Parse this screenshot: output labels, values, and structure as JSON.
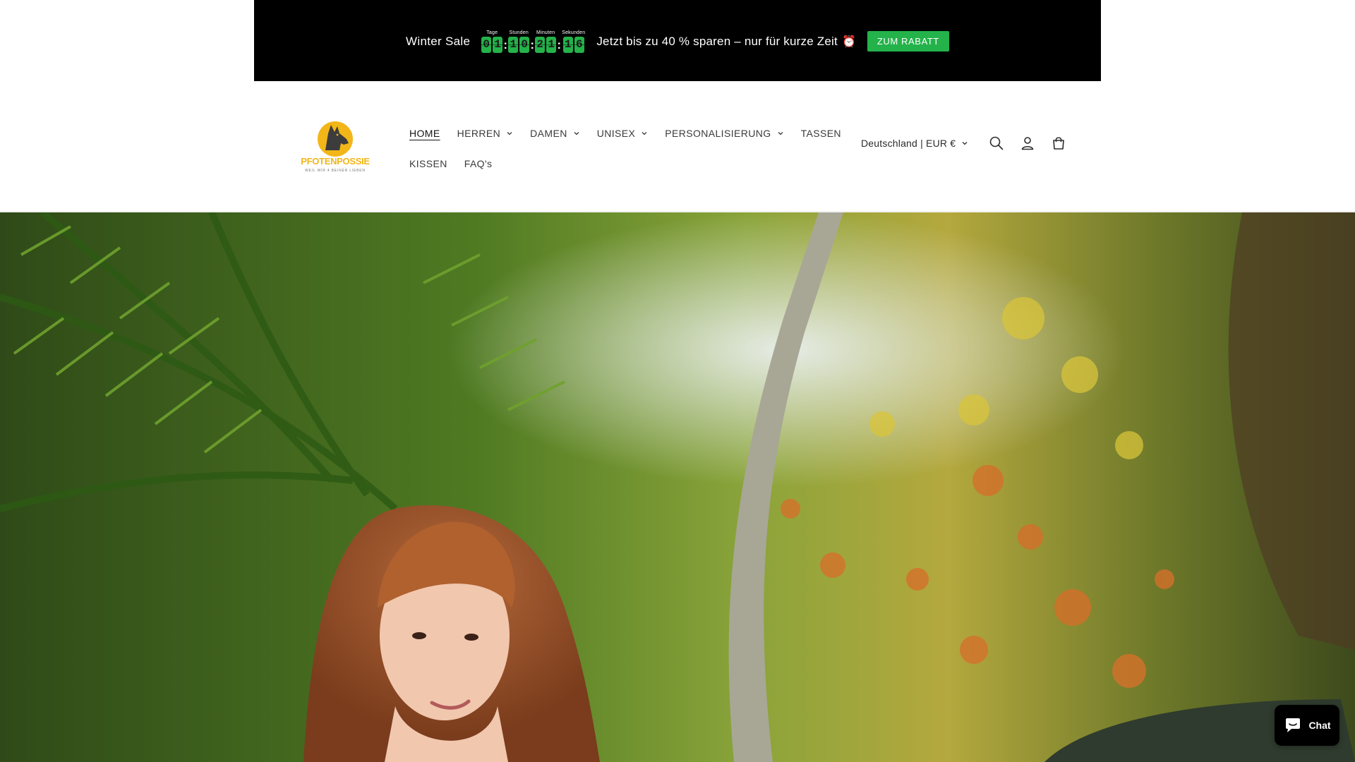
{
  "announcement": {
    "title": "Winter Sale",
    "countdown": {
      "days_label": "Tage",
      "hours_label": "Stunden",
      "minutes_label": "Minuten",
      "seconds_label": "Sekunden",
      "days": [
        "0",
        "1"
      ],
      "hours": [
        "1",
        "0"
      ],
      "minutes": [
        "2",
        "1"
      ],
      "seconds": [
        "1",
        "6"
      ],
      "separator": ":"
    },
    "text": "Jetzt bis zu 40 % sparen – nur für kurze Zeit",
    "clock_glyph": "⏰",
    "button_label": "ZUM RABATT",
    "background": "#000000",
    "accent": "#24b24a"
  },
  "logo": {
    "name": "PFOTENPOSSIE",
    "tagline": "WEIL WIR 4 BEINER LIEBEN",
    "brand_color": "#f2b618"
  },
  "nav": {
    "row1": [
      {
        "label": "HOME",
        "active": true,
        "dropdown": false
      },
      {
        "label": "HERREN",
        "active": false,
        "dropdown": true
      },
      {
        "label": "DAMEN",
        "active": false,
        "dropdown": true
      },
      {
        "label": "UNISEX",
        "active": false,
        "dropdown": true
      },
      {
        "label": "PERSONALISIERUNG",
        "active": false,
        "dropdown": true
      },
      {
        "label": "TASSEN",
        "active": false,
        "dropdown": false
      }
    ],
    "row2": [
      {
        "label": "KISSEN",
        "active": false,
        "dropdown": false
      },
      {
        "label": "FAQ's",
        "active": false,
        "dropdown": false
      }
    ]
  },
  "header_actions": {
    "locale": "Deutschland | EUR €",
    "icons": [
      "search-icon",
      "account-icon",
      "cart-icon"
    ]
  },
  "chat": {
    "label": "Chat"
  }
}
